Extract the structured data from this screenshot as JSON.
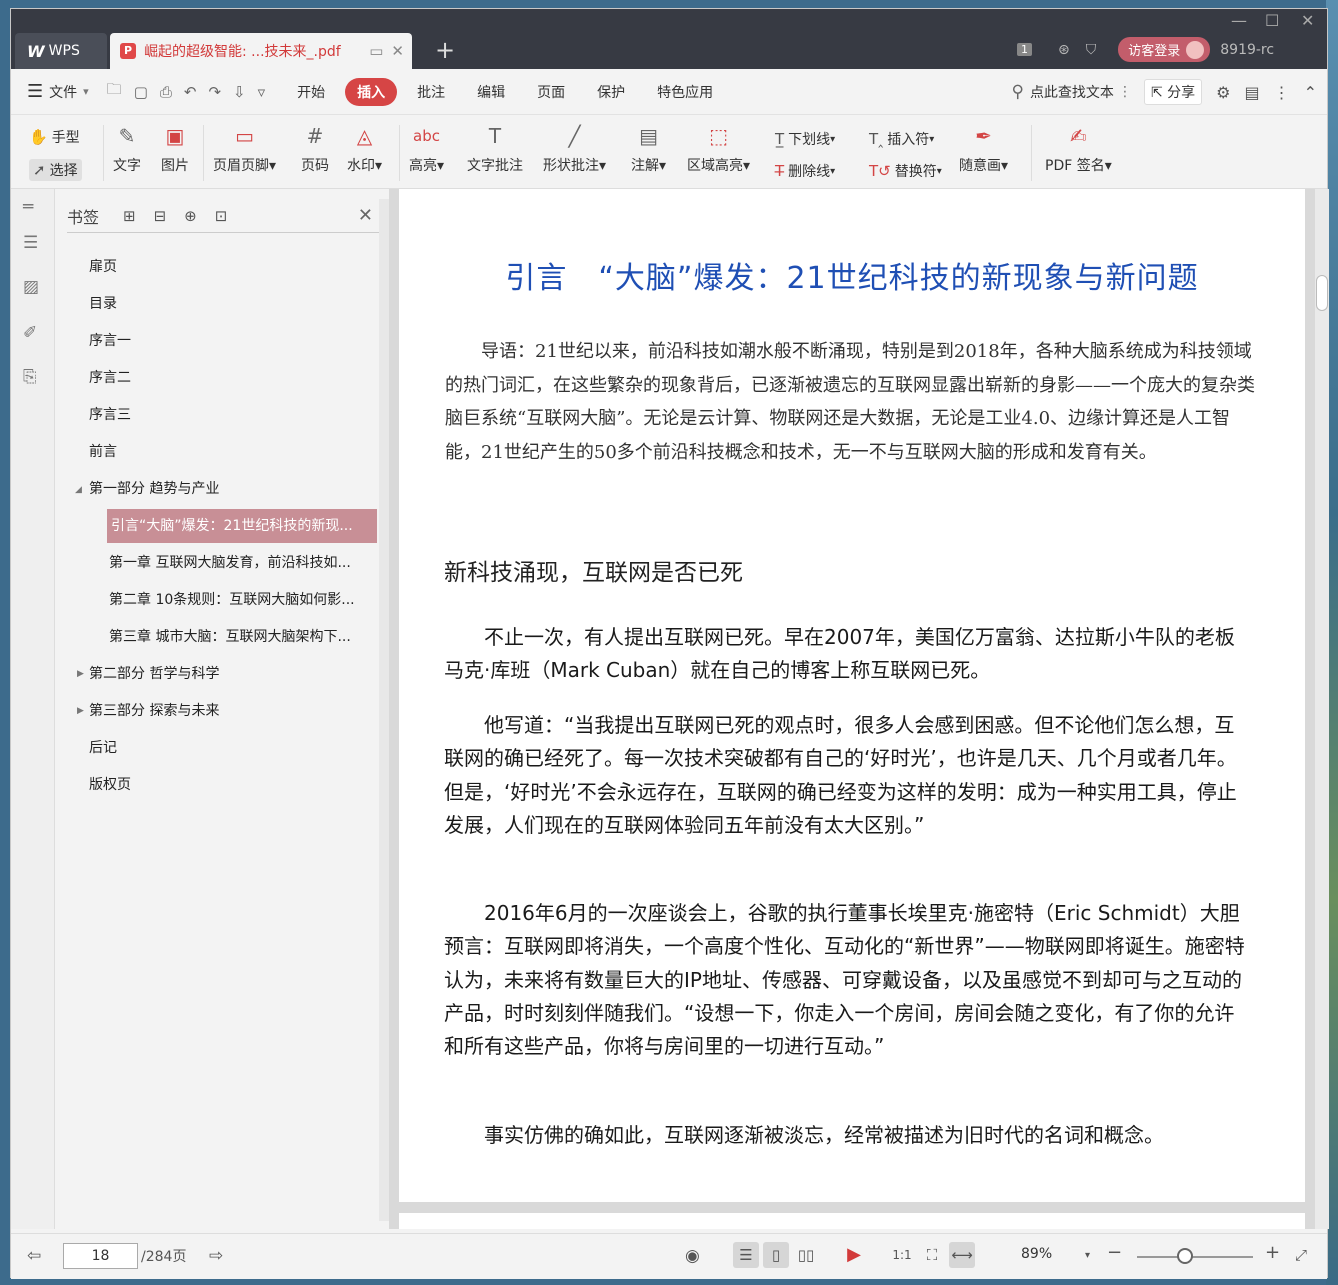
{
  "titlebar": {
    "app_tab": "WPS",
    "app_logo": "W",
    "doc_tab": "崛起的超级智能: ...技未来_.pdf",
    "page_badge": "1",
    "login": "访客登录",
    "user_id": "8919-rc"
  },
  "menubar": {
    "file": "文件",
    "tabs": [
      "开始",
      "插入",
      "批注",
      "编辑",
      "页面",
      "保护",
      "特色应用"
    ],
    "active_tab": "插入",
    "search": "点此查找文本",
    "share": "分享"
  },
  "toolbar": {
    "hand": "手型",
    "select": "选择",
    "text": "文字",
    "image": "图片",
    "header_footer": "页眉页脚",
    "page_num": "页码",
    "watermark": "水印",
    "highlight": "高亮",
    "text_comment": "文字批注",
    "shape_comment": "形状批注",
    "note": "注解",
    "area_highlight": "区域高亮",
    "underline": "下划线",
    "strikethrough": "删除线",
    "insert_mark": "插入符",
    "replace_mark": "替换符",
    "freehand": "随意画",
    "pdf_sign": "PDF 签名"
  },
  "bookmarks": {
    "title": "书签",
    "items": [
      "扉页",
      "目录",
      "序言一",
      "序言二",
      "序言三",
      "前言",
      "第一部分 趋势与产业",
      "引言“大脑”爆发：21世纪科技的新现...",
      "第一章 互联网大脑发育，前沿科技如...",
      "第二章 10条规则：互联网大脑如何影...",
      "第三章 城市大脑：互联网大脑架构下...",
      "第二部分 哲学与科学",
      "第三部分 探索与未来",
      "后记",
      "版权页"
    ]
  },
  "document": {
    "title": "引言　“大脑”爆发：21世纪科技的新现象与新问题",
    "intro": "导语：21世纪以来，前沿科技如潮水般不断涌现，特别是到2018年，各种大脑系统成为科技领域的热门词汇，在这些繁杂的现象背后，已逐渐被遗忘的互联网显露出崭新的身影——一个庞大的复杂类脑巨系统“互联网大脑”。无论是云计算、物联网还是大数据，无论是工业4.0、边缘计算还是人工智能，21世纪产生的50多个前沿科技概念和技术，无一不与互联网大脑的形成和发育有关。",
    "section": "新科技涌现，互联网是否已死",
    "paragraphs": [
      "不止一次，有人提出互联网已死。早在2007年，美国亿万富翁、达拉斯小牛队的老板马克·库班（Mark Cuban）就在自己的博客上称互联网已死。",
      "他写道：“当我提出互联网已死的观点时，很多人会感到困惑。但不论他们怎么想，互联网的确已经死了。每一次技术突破都有自己的‘好时光’，也许是几天、几个月或者几年。但是，‘好时光’不会永远存在，互联网的确已经变为这样的发明：成为一种实用工具，停止发展，人们现在的互联网体验同五年前没有太大区别。”",
      "2016年6月的一次座谈会上，谷歌的执行董事长埃里克·施密特（Eric Schmidt）大胆预言：互联网即将消失，一个高度个性化、互动化的“新世界”——物联网即将诞生。施密特认为，未来将有数量巨大的IP地址、传感器、可穿戴设备，以及虽感觉不到却可与之互动的产品，时时刻刻伴随我们。“设想一下，你走入一个房间，房间会随之变化，有了你的允许和所有这些产品，你将与房间里的一切进行互动。”",
      "事实仿佛的确如此，互联网逐渐被淡忘，经常被描述为旧时代的名词和概念。"
    ]
  },
  "statusbar": {
    "current_page": "18",
    "total_pages": "/284页",
    "zoom": "89%",
    "zoom_level_percent": 89
  },
  "colors": {
    "titlebar_bg": "#373a43",
    "accent_red": "#d64545",
    "bookmark_selected": "#c88f96",
    "doc_title_blue": "#1f4fb4"
  }
}
